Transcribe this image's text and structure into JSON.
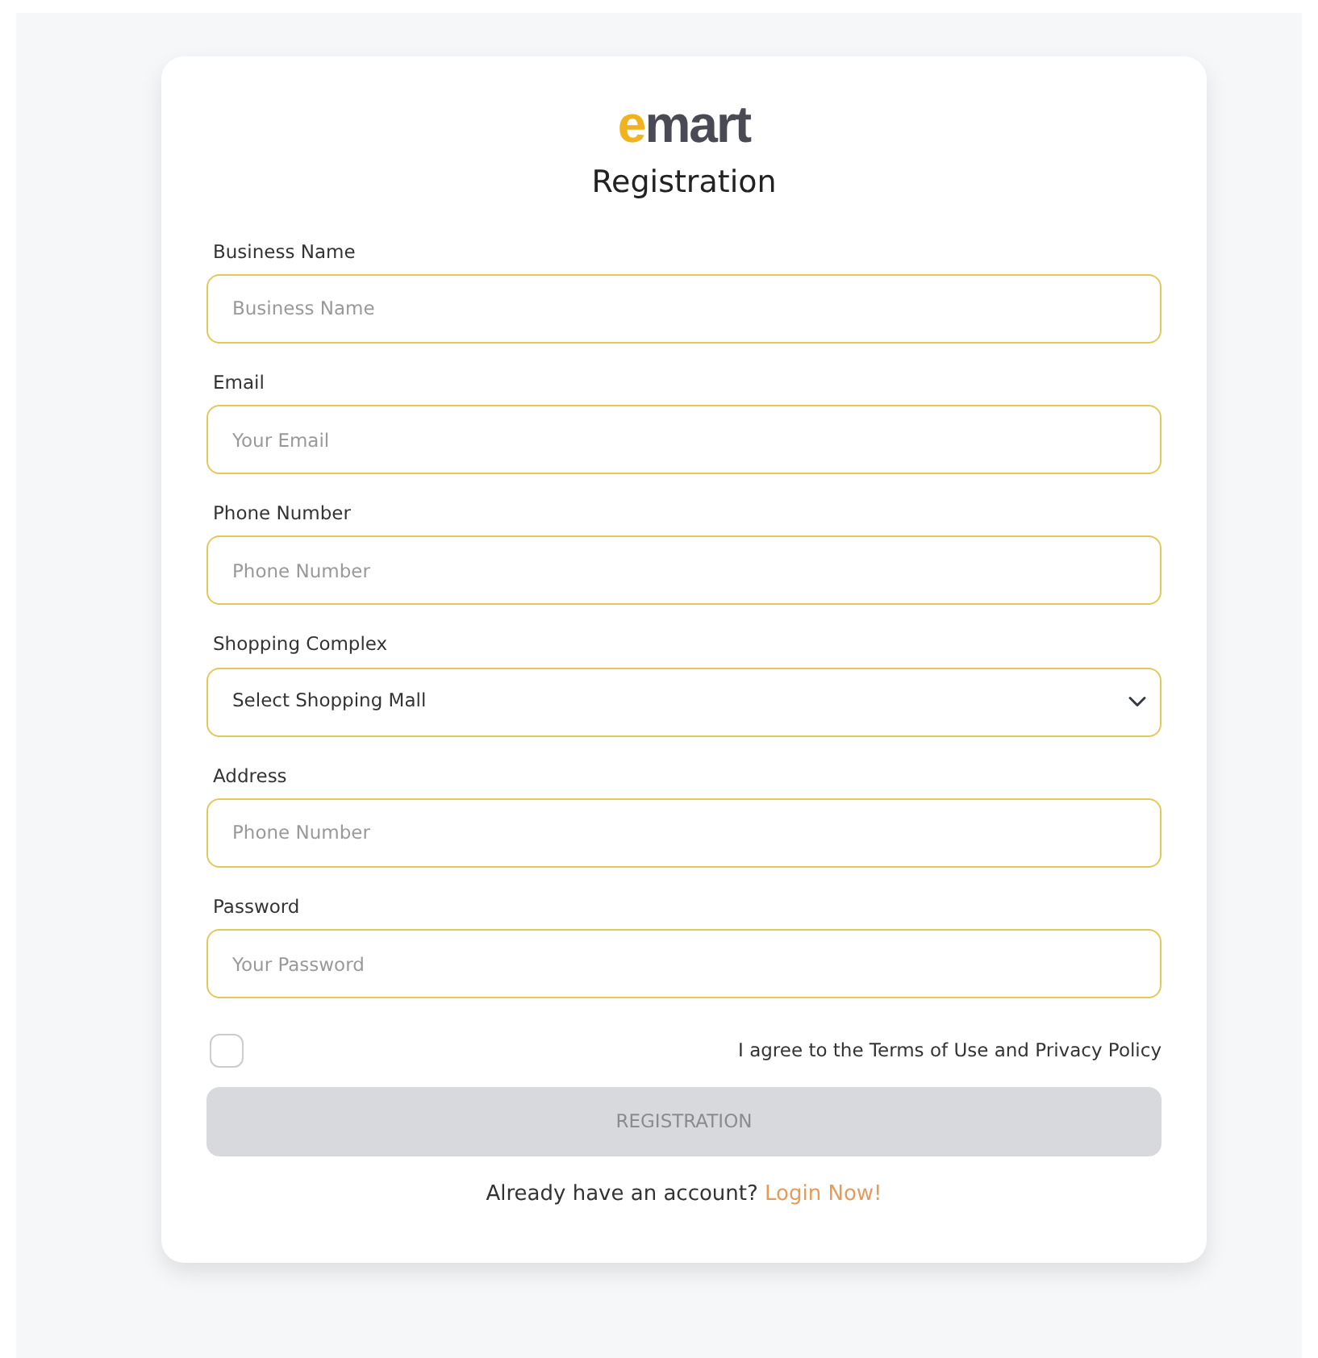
{
  "logo": {
    "accent": "e",
    "rest": "mart"
  },
  "title": "Registration",
  "fields": [
    {
      "kind": "input",
      "label": "Business Name",
      "placeholder": "Business Name"
    },
    {
      "kind": "input",
      "label": "Email",
      "placeholder": "Your Email"
    },
    {
      "kind": "input",
      "label": "Phone Number",
      "placeholder": "Phone Number"
    },
    {
      "kind": "select",
      "label": "Shopping Complex",
      "value": "Select Shopping Mall"
    },
    {
      "kind": "input",
      "label": "Address",
      "placeholder": "Phone Number"
    },
    {
      "kind": "password",
      "label": "Password",
      "placeholder": "Your Password"
    }
  ],
  "agree": {
    "checked": false,
    "label": "I agree to the Terms of Use and Privacy Policy"
  },
  "submit": {
    "label": "REGISTRATION",
    "disabled": true
  },
  "footer": {
    "text": "Already have an account?",
    "link": "Login Now!"
  }
}
